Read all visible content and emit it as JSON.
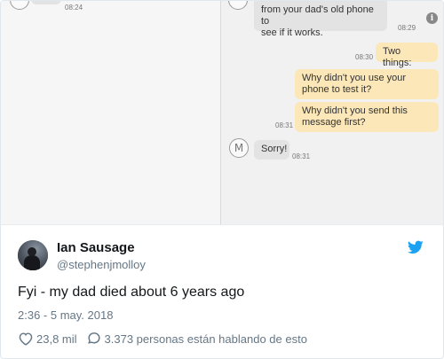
{
  "screenshot": {
    "left_timestamp": "08:24",
    "messages": [
      {
        "text_line1": "from your dad's old phone to",
        "text_line2": "see if it works.",
        "time": "08:29",
        "dir": "in"
      },
      {
        "text": "Two things:",
        "time": "08:30",
        "dir": "out"
      },
      {
        "text_line1": "Why didn't you use your",
        "text_line2": "phone to test it?",
        "dir": "out"
      },
      {
        "text_line1": "Why didn't you send this",
        "text_line2": "message first?",
        "time": "08:31",
        "dir": "out"
      },
      {
        "avatar_letter": "M",
        "text": "Sorry!",
        "time": "08:31",
        "dir": "in"
      }
    ]
  },
  "tweet": {
    "author_name": "Ian Sausage",
    "author_handle": "@stephenjmolloy",
    "text": "Fyi - my dad died about 6 years ago",
    "timestamp": "2:36 - 5 may. 2018",
    "likes": "23,8 mil",
    "conversation": "3.373 personas están hablando de esto"
  },
  "colors": {
    "outgoing_bubble": "#fbe7b8",
    "incoming_bubble": "#e3e3e3",
    "twitter_blue": "#1da1f2"
  }
}
